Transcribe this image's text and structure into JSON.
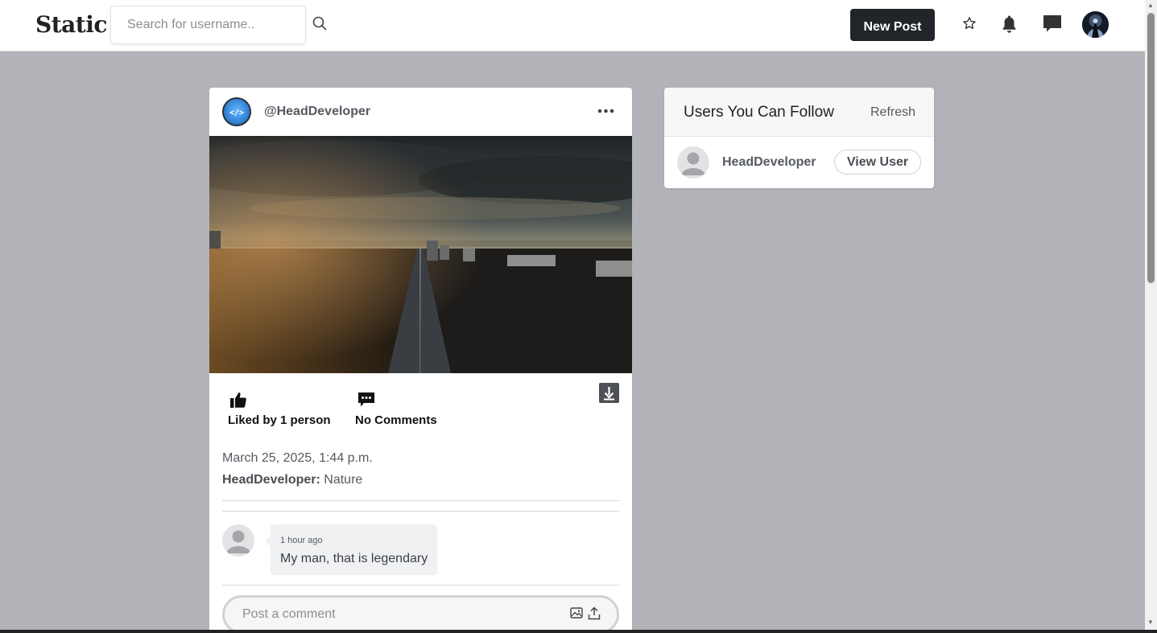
{
  "header": {
    "brand": "Static",
    "search_placeholder": "Search for username..",
    "new_post_label": "New Post",
    "icons": [
      "search-icon",
      "star-icon",
      "bell-icon",
      "chat-icon",
      "user-avatar"
    ]
  },
  "post": {
    "username": "@HeadDeveloper",
    "likes_label": "Liked by 1 person",
    "comments_label": "No Comments",
    "date": "March 25, 2025, 1:44 p.m.",
    "caption_author": "HeadDeveloper:",
    "caption_text": " Nature",
    "comments": [
      {
        "time": "1 hour ago",
        "text": "My man, that is legendary"
      }
    ],
    "comment_placeholder": "Post a comment"
  },
  "follow_panel": {
    "title": "Users You Can Follow",
    "refresh_label": "Refresh",
    "users": [
      {
        "name": "HeadDeveloper",
        "action_label": "View User"
      }
    ]
  },
  "colors": {
    "background": "#b1b3b8",
    "primary_button": "#212529",
    "card": "#ffffff"
  }
}
